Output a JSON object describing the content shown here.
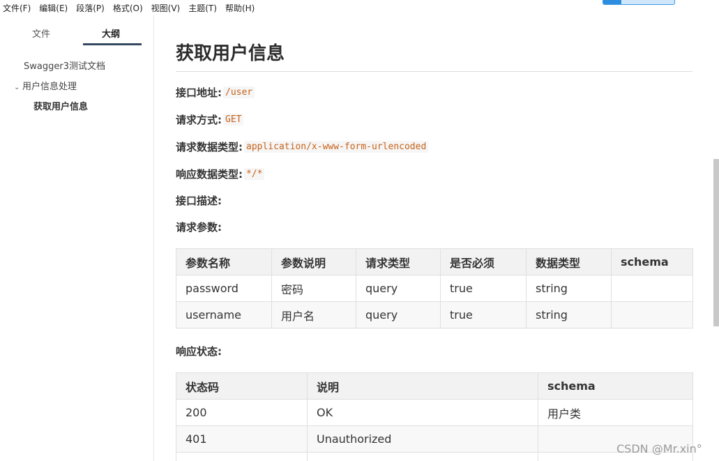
{
  "menu": [
    "文件(F)",
    "编辑(E)",
    "段落(P)",
    "格式(O)",
    "视图(V)",
    "主题(T)",
    "帮助(H)"
  ],
  "sidebar": {
    "tabs": {
      "files": "文件",
      "outline": "大纲"
    },
    "outline": {
      "root": "Swagger3测试文档",
      "group": "用户信息处理",
      "leaf": "获取用户信息"
    }
  },
  "doc": {
    "title": "获取用户信息",
    "fields": {
      "url_label": "接口地址:",
      "url_value": "/user",
      "method_label": "请求方式:",
      "method_value": "GET",
      "req_type_label": "请求数据类型:",
      "req_type_value": "application/x-www-form-urlencoded",
      "resp_type_label": "响应数据类型:",
      "resp_type_value": "*/*",
      "desc_label": "接口描述:",
      "params_label": "请求参数:",
      "status_label": "响应状态:"
    },
    "params_table": {
      "headers": [
        "参数名称",
        "参数说明",
        "请求类型",
        "是否必须",
        "数据类型",
        "schema"
      ],
      "rows": [
        [
          "password",
          "密码",
          "query",
          "true",
          "string",
          ""
        ],
        [
          "username",
          "用户名",
          "query",
          "true",
          "string",
          ""
        ]
      ]
    },
    "status_table": {
      "headers": [
        "状态码",
        "说明",
        "schema"
      ],
      "rows": [
        [
          "200",
          "OK",
          "用户类"
        ],
        [
          "401",
          "Unauthorized",
          ""
        ],
        [
          "",
          "",
          ""
        ]
      ]
    }
  },
  "watermark": "CSDN @Mr.xin°",
  "colors": {
    "accent": "#34495e",
    "code": "#c7621a"
  }
}
